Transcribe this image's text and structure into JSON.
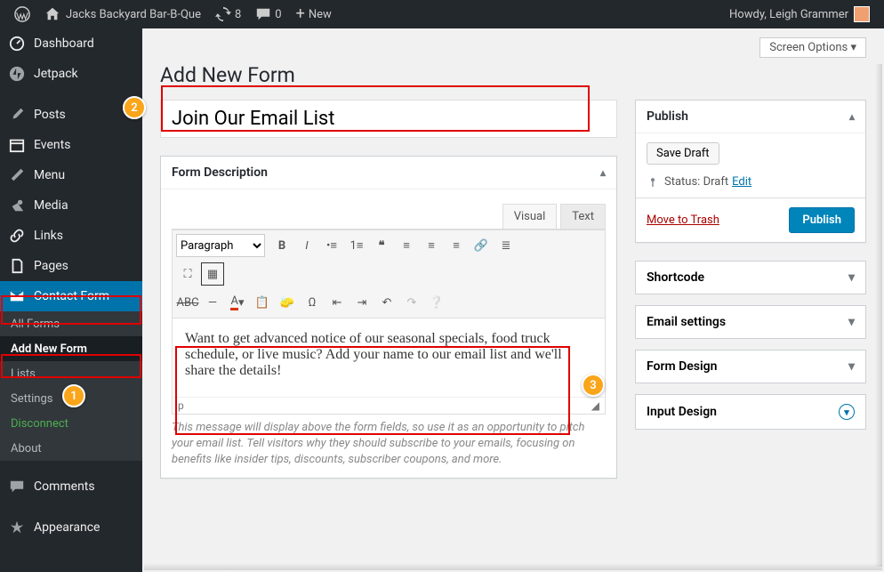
{
  "adminbar": {
    "site": "Jacks Backyard Bar-B-Que",
    "updates": "8",
    "comments": "0",
    "new": "New",
    "howdy": "Howdy, Leigh Grammer"
  },
  "screen_options": "Screen Options ▾",
  "page_title": "Add New Form",
  "form_title": "Join Our Email List",
  "side": {
    "dashboard": "Dashboard",
    "jetpack": "Jetpack",
    "posts": "Posts",
    "events": "Events",
    "menu": "Menu",
    "media": "Media",
    "links": "Links",
    "pages": "Pages",
    "contact_form": "Contact Form",
    "sub": {
      "all": "All Forms",
      "add": "Add New Form",
      "lists": "Lists",
      "settings": "Settings",
      "disconnect": "Disconnect",
      "about": "About"
    },
    "comments_label": "Comments",
    "appearance": "Appearance"
  },
  "desc": {
    "head": "Form Description",
    "tabs": {
      "visual": "Visual",
      "text": "Text"
    },
    "paragraph": "Paragraph",
    "body": "Want to get advanced notice of our seasonal specials, food truck schedule, or live music? Add your name to our email list and we'll share the details!",
    "path": "p",
    "hint": "This message will display above the form fields, so use it as an opportunity to pitch your email list. Tell visitors why they should subscribe to your emails, focusing on benefits like insider tips, discounts, subscriber coupons, and more."
  },
  "publish": {
    "head": "Publish",
    "save": "Save Draft",
    "status_label": "Status:",
    "status_value": "Draft",
    "edit": "Edit",
    "trash": "Move to Trash",
    "button": "Publish"
  },
  "accordions": {
    "shortcode": "Shortcode",
    "email": "Email settings",
    "formdesign": "Form Design",
    "inputdesign": "Input Design"
  },
  "badges": {
    "one": "1",
    "two": "2",
    "three": "3"
  }
}
